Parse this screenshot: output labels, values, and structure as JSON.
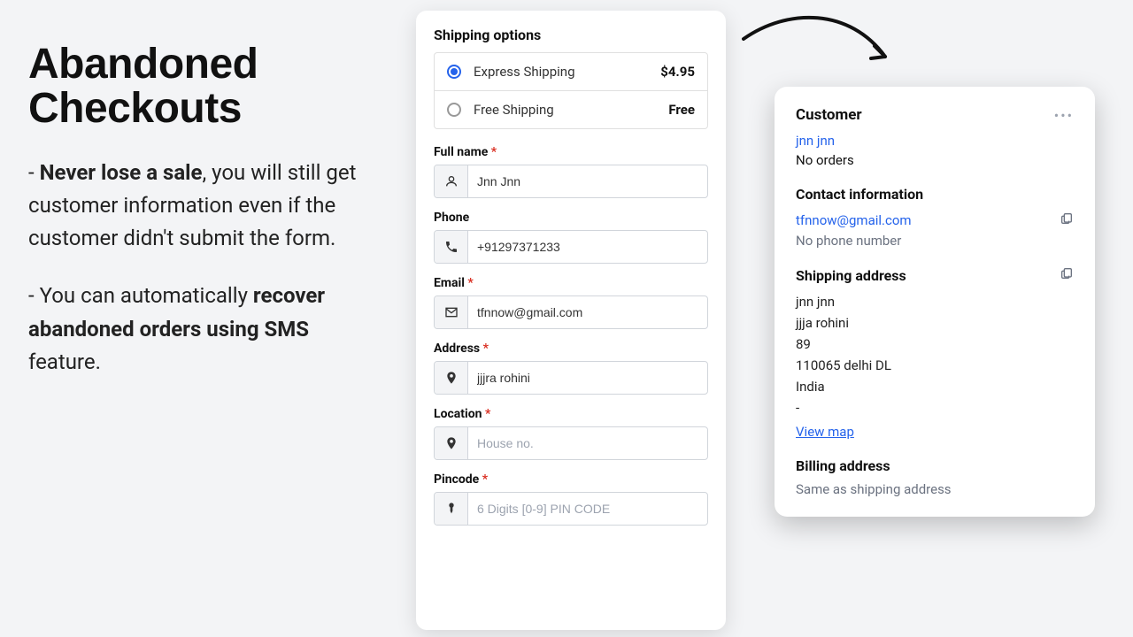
{
  "left": {
    "headline_l1": "Abandoned",
    "headline_l2": "Checkouts",
    "p1_prefix": "- ",
    "p1_bold": "Never lose a sale",
    "p1_rest": ", you will still get customer information even if the customer didn't submit the form.",
    "p2_prefix": "- You can automatically ",
    "p2_bold": "recover abandoned orders using SMS",
    "p2_rest": " feature."
  },
  "form": {
    "shipping_title": "Shipping options",
    "options": [
      {
        "label": "Express Shipping",
        "price": "$4.95",
        "checked": true
      },
      {
        "label": "Free Shipping",
        "price": "Free",
        "checked": false
      }
    ],
    "fields": {
      "fullname": {
        "label": "Full name",
        "required": true,
        "value": "Jnn Jnn",
        "placeholder": ""
      },
      "phone": {
        "label": "Phone",
        "required": false,
        "value": "+91297371233",
        "placeholder": ""
      },
      "email": {
        "label": "Email",
        "required": true,
        "value": "tfnnow@gmail.com",
        "placeholder": ""
      },
      "address": {
        "label": "Address",
        "required": true,
        "value": "jjjra rohini",
        "placeholder": ""
      },
      "location": {
        "label": "Location",
        "required": true,
        "value": "",
        "placeholder": "House no."
      },
      "pincode": {
        "label": "Pincode",
        "required": true,
        "value": "",
        "placeholder": "6 Digits [0-9] PIN CODE"
      }
    }
  },
  "customer": {
    "title": "Customer",
    "name_link": "jnn jnn",
    "orders": "No orders",
    "contact_title": "Contact information",
    "email": "tfnnow@gmail.com",
    "phone": "No phone number",
    "shipping_title": "Shipping address",
    "addr_lines": [
      "jnn jnn",
      "jjja rohini",
      "89",
      "110065 delhi DL",
      "India",
      "-"
    ],
    "view_map": "View map",
    "billing_title": "Billing address",
    "billing_same": "Same as shipping address"
  }
}
